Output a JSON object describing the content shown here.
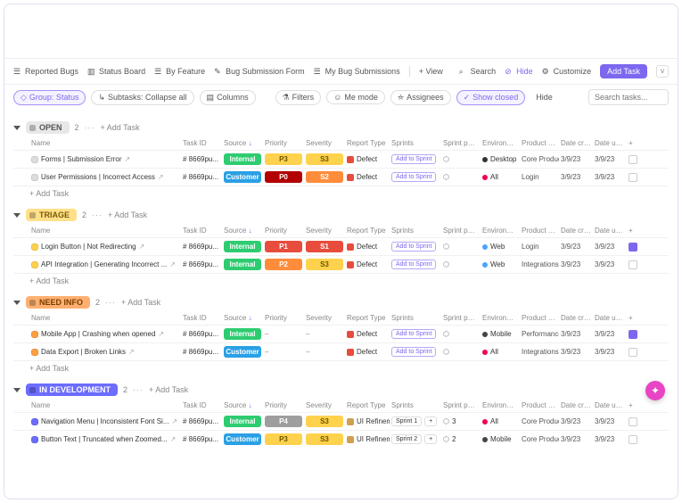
{
  "toolbar": {
    "views": [
      {
        "label": "Reported Bugs",
        "icon": "list"
      },
      {
        "label": "Status Board",
        "icon": "board"
      },
      {
        "label": "By Feature",
        "icon": "list"
      },
      {
        "label": "Bug Submission Form",
        "icon": "form"
      },
      {
        "label": "My Bug Submissions",
        "icon": "list"
      }
    ],
    "add_view": "+ View",
    "search": "Search",
    "hide": "Hide",
    "customize": "Customize",
    "add_task": "Add Task"
  },
  "filters": {
    "group": "Group: Status",
    "subtasks": "Subtasks: Collapse all",
    "columns": "Columns",
    "filters": "Filters",
    "me_mode": "Me mode",
    "assignees": "Assignees",
    "show_closed": "Show closed",
    "hide": "Hide",
    "search_placeholder": "Search tasks..."
  },
  "columns": {
    "name": "Name",
    "task_id": "Task ID",
    "source": "Source",
    "priority": "Priority",
    "severity": "Severity",
    "report_type": "Report Type",
    "sprints": "Sprints",
    "sprint_points": "Sprint poin...",
    "environment": "Environment",
    "product_feature": "Product Feature",
    "date_created": "Date creat...",
    "date_updated": "Date upda..."
  },
  "labels": {
    "plus_add_task": "+ Add Task",
    "add_to_sprint": "Add to Sprint",
    "dots": "···"
  },
  "groups": [
    {
      "id": "open",
      "label": "OPEN",
      "chip": "chip-open",
      "dot": "sd-open",
      "count": "2",
      "rows": [
        {
          "name": "Forms | Submission Error",
          "task_id": "# 8669pu...",
          "source": "Internal",
          "source_cls": "b-internal",
          "priority": "P3",
          "priority_cls": "b-p3",
          "severity": "S3",
          "severity_cls": "b-s3",
          "report_type": "Defect",
          "rt_cls": "rt-ico",
          "sprint": "add",
          "sp": "",
          "env": "Desktop",
          "env_cls": "env-desktop",
          "feature": "Core Product",
          "created": "3/9/23",
          "updated": "3/9/23",
          "check": ""
        },
        {
          "name": "User Permissions | Incorrect Access",
          "task_id": "# 8669pu...",
          "source": "Customer",
          "source_cls": "b-customer",
          "priority": "P0",
          "priority_cls": "b-p0",
          "severity": "S2",
          "severity_cls": "b-s2",
          "report_type": "Defect",
          "rt_cls": "rt-ico",
          "sprint": "add",
          "sp": "",
          "env": "All",
          "env_cls": "env-all",
          "feature": "Login",
          "created": "3/9/23",
          "updated": "3/9/23",
          "check": ""
        }
      ]
    },
    {
      "id": "triage",
      "label": "TRIAGE",
      "chip": "chip-triage",
      "dot": "sd-triage",
      "count": "2",
      "rows": [
        {
          "name": "Login Button | Not Redirecting",
          "task_id": "# 8669pu...",
          "source": "Internal",
          "source_cls": "b-internal",
          "priority": "P1",
          "priority_cls": "b-p1",
          "severity": "S1",
          "severity_cls": "b-s1",
          "report_type": "Defect",
          "rt_cls": "rt-ico",
          "sprint": "add",
          "sp": "",
          "env": "Web",
          "env_cls": "env-web",
          "feature": "Login",
          "created": "3/9/23",
          "updated": "3/9/23",
          "check": "purple"
        },
        {
          "name": "API Integration | Generating Incorrect ...",
          "task_id": "# 8669pu...",
          "source": "Internal",
          "source_cls": "b-internal",
          "priority": "P2",
          "priority_cls": "b-p2",
          "severity": "S3",
          "severity_cls": "b-s3",
          "report_type": "Defect",
          "rt_cls": "rt-ico",
          "sprint": "add",
          "sp": "",
          "env": "Web",
          "env_cls": "env-web",
          "feature": "Integrations",
          "created": "3/9/23",
          "updated": "3/9/23",
          "check": ""
        }
      ]
    },
    {
      "id": "needinfo",
      "label": "NEED INFO",
      "chip": "chip-needinfo",
      "dot": "sd-needinfo",
      "count": "2",
      "rows": [
        {
          "name": "Mobile App | Crashing when opened",
          "task_id": "# 8669pu...",
          "source": "Internal",
          "source_cls": "b-internal",
          "priority": "–",
          "priority_cls": "",
          "severity": "–",
          "severity_cls": "",
          "report_type": "Defect",
          "rt_cls": "rt-ico",
          "sprint": "add",
          "sp": "",
          "env": "Mobile",
          "env_cls": "env-mobile",
          "feature": "Performance",
          "created": "3/9/23",
          "updated": "3/9/23",
          "check": "purple"
        },
        {
          "name": "Data Export | Broken Links",
          "task_id": "# 8669pu...",
          "source": "Customer",
          "source_cls": "b-customer",
          "priority": "–",
          "priority_cls": "",
          "severity": "–",
          "severity_cls": "",
          "report_type": "Defect",
          "rt_cls": "rt-ico",
          "sprint": "add",
          "sp": "",
          "env": "All",
          "env_cls": "env-all",
          "feature": "Integrations",
          "created": "3/9/23",
          "updated": "3/9/23",
          "check": ""
        }
      ]
    },
    {
      "id": "indev",
      "label": "IN DEVELOPMENT",
      "chip": "chip-indev",
      "dot": "sd-indev",
      "count": "2",
      "rows": [
        {
          "name": "Navigation Menu | Inconsistent Font Si...",
          "task_id": "# 8669pu...",
          "source": "Internal",
          "source_cls": "b-internal",
          "priority": "P4",
          "priority_cls": "b-p4",
          "severity": "S3",
          "severity_cls": "b-s3",
          "report_type": "UI Refinem...",
          "rt_cls": "rt-ico rt-ui",
          "sprint": "Sprint 1",
          "sprint_extra": "+",
          "sp": "3",
          "env": "All",
          "env_cls": "env-all",
          "feature": "Core Product",
          "created": "3/9/23",
          "updated": "3/9/23",
          "check": ""
        },
        {
          "name": "Button Text | Truncated when Zoomed...",
          "task_id": "# 8669pu...",
          "source": "Customer",
          "source_cls": "b-customer",
          "priority": "P3",
          "priority_cls": "b-p3",
          "severity": "S3",
          "severity_cls": "b-s3",
          "report_type": "UI Refinem...",
          "rt_cls": "rt-ico rt-ui",
          "sprint": "Sprint 2",
          "sprint_extra": "+",
          "sp": "2",
          "env": "Mobile",
          "env_cls": "env-mobile",
          "feature": "Core Product",
          "created": "3/9/23",
          "updated": "3/9/23",
          "check": ""
        }
      ]
    }
  ]
}
